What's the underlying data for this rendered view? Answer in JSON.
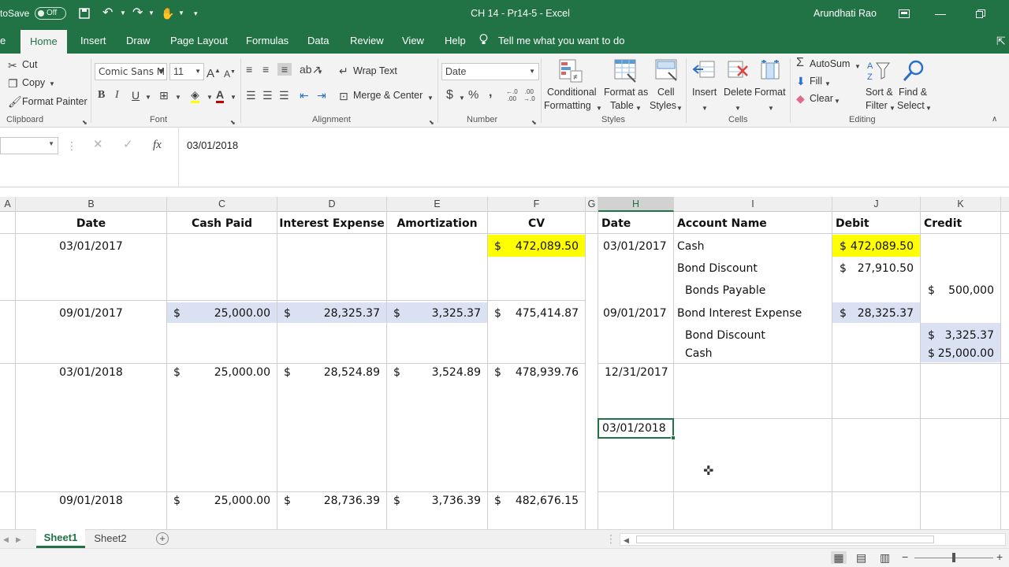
{
  "titlebar": {
    "autosave_label": "toSave",
    "autosave_state": "Off",
    "document_title": "CH 14 - Pr14-5  -  Excel",
    "user_name": "Arundhati Rao"
  },
  "ribbon_tabs": [
    "Home",
    "Insert",
    "Draw",
    "Page Layout",
    "Formulas",
    "Data",
    "Review",
    "View",
    "Help"
  ],
  "tell_me": "Tell me what you want to do",
  "clipboard": {
    "cut": "Cut",
    "copy": "Copy",
    "format_painter": "Format Painter",
    "group": "Clipboard"
  },
  "font": {
    "name": "Comic Sans M",
    "size": "11",
    "bold": "B",
    "italic": "I",
    "underline": "U",
    "group": "Font"
  },
  "alignment": {
    "wrap_text": "Wrap Text",
    "merge_center": "Merge & Center",
    "group": "Alignment"
  },
  "number": {
    "format": "Date",
    "currency": "$",
    "percent": "%",
    "comma": ",",
    "inc_decimal": ".0\n.00",
    "dec_decimal": ".00\n.0",
    "group": "Number"
  },
  "styles": {
    "conditional_1": "Conditional",
    "conditional_2": "Formatting",
    "table_1": "Format as",
    "table_2": "Table",
    "cell_1": "Cell",
    "cell_2": "Styles",
    "group": "Styles"
  },
  "cells": {
    "insert": "Insert",
    "delete": "Delete",
    "format": "Format",
    "group": "Cells"
  },
  "editing": {
    "autosum": "AutoSum",
    "fill": "Fill",
    "clear": "Clear",
    "sort_1": "Sort &",
    "sort_2": "Filter",
    "find_1": "Find &",
    "find_2": "Select",
    "group": "Editing"
  },
  "formula_bar": {
    "fx": "fx",
    "value": "03/01/2018"
  },
  "columns": [
    "A",
    "B",
    "C",
    "D",
    "E",
    "F",
    "G",
    "H",
    "I",
    "J",
    "K"
  ],
  "left_table": {
    "headers": [
      "Date",
      "Cash Paid",
      "Interest Expense",
      "Amortization",
      "CV"
    ],
    "rows": [
      {
        "date": "03/01/2017",
        "cash": "",
        "interest": "",
        "amort": "",
        "cv": "472,089.50"
      },
      {
        "date": "09/01/2017",
        "cash": "25,000.00",
        "interest": "28,325.37",
        "amort": "3,325.37",
        "cv": "475,414.87"
      },
      {
        "date": "03/01/2018",
        "cash": "25,000.00",
        "interest": "28,524.89",
        "amort": "3,524.89",
        "cv": "478,939.76"
      },
      {
        "date": "09/01/2018",
        "cash": "25,000.00",
        "interest": "28,736.39",
        "amort": "3,736.39",
        "cv": "482,676.15"
      }
    ]
  },
  "journal": {
    "headers": [
      "Date",
      "Account Name",
      "Debit",
      "Credit"
    ],
    "entries": [
      {
        "date": "03/01/2017",
        "account": "Cash",
        "debit": "472,089.50",
        "credit": ""
      },
      {
        "date": "",
        "account": "Bond Discount",
        "debit": "27,910.50",
        "credit": ""
      },
      {
        "date": "",
        "account": "Bonds Payable",
        "debit": "",
        "credit": "500,000"
      },
      {
        "date": "09/01/2017",
        "account": "Bond Interest Expense",
        "debit": "28,325.37",
        "credit": ""
      },
      {
        "date": "",
        "account": "Bond Discount",
        "debit": "",
        "credit": "3,325.37"
      },
      {
        "date": "",
        "account": "Cash",
        "debit": "",
        "credit": "25,000.00"
      },
      {
        "date": "12/31/2017",
        "account": "",
        "debit": "",
        "credit": ""
      },
      {
        "date": "03/01/2018",
        "account": "",
        "debit": "",
        "credit": ""
      }
    ]
  },
  "currency_symbol": "$",
  "sheets": [
    "Sheet1",
    "Sheet2"
  ],
  "active_sheet": "Sheet1",
  "colors": {
    "excel_green": "#217346",
    "highlight_yellow": "#ffff00",
    "highlight_blue": "#d9e1f2"
  }
}
